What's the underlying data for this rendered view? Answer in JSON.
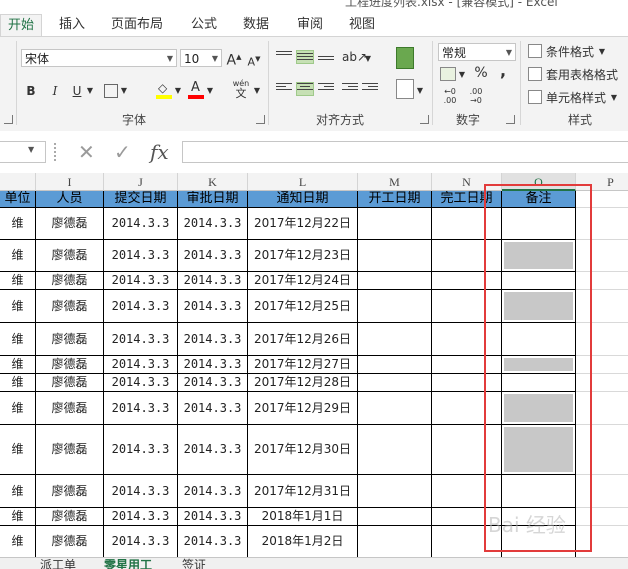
{
  "window": {
    "title": "工程进度列表.xlsx - [兼容模式] - Excel"
  },
  "tabs": [
    "开始",
    "插入",
    "页面布局",
    "公式",
    "数据",
    "审阅",
    "视图"
  ],
  "ribbon": {
    "font_name": "宋体",
    "font_size": "10",
    "grow_font": "A",
    "shrink_font": "A",
    "bold": "B",
    "italic": "I",
    "underline": "U",
    "font_color_letter": "A",
    "phonetic": "wén",
    "phonetic_sub": "文",
    "number_format": "常规",
    "percent": "%",
    "comma": ",",
    "conditional_formatting": "条件格式",
    "format_as_table": "套用表格格式",
    "cell_styles": "单元格样式",
    "group_font": "字体",
    "group_alignment": "对齐方式",
    "group_number": "数字",
    "group_styles": "样式",
    "dec_increase_top": "←0",
    "dec_increase_bottom": ".00",
    "dec_decrease_top": ".00",
    "dec_decrease_bottom": "→0"
  },
  "formula_bar": {
    "fx": "fx",
    "cancel": "✕",
    "enter": "✓",
    "content": ""
  },
  "columns": [
    "I",
    "J",
    "K",
    "L",
    "M",
    "N",
    "O",
    "P"
  ],
  "table": {
    "headers": [
      "单位",
      "人员",
      "提交日期",
      "审批日期",
      "通知日期",
      "开工日期",
      "完工日期",
      "备注"
    ],
    "rows": [
      {
        "unit": "维",
        "person": "廖德磊",
        "submit": "2014.3.3",
        "approve": "2014.3.3",
        "notice": "2017年12月22日",
        "remark_grey": false
      },
      {
        "unit": "维",
        "person": "廖德磊",
        "submit": "2014.3.3",
        "approve": "2014.3.3",
        "notice": "2017年12月23日",
        "remark_grey": true
      },
      {
        "unit": "维",
        "person": "廖德磊",
        "submit": "2014.3.3",
        "approve": "2014.3.3",
        "notice": "2017年12月24日",
        "remark_grey": false
      },
      {
        "unit": "维",
        "person": "廖德磊",
        "submit": "2014.3.3",
        "approve": "2014.3.3",
        "notice": "2017年12月25日",
        "remark_grey": true
      },
      {
        "unit": "维",
        "person": "廖德磊",
        "submit": "2014.3.3",
        "approve": "2014.3.3",
        "notice": "2017年12月26日",
        "remark_grey": false
      },
      {
        "unit": "维",
        "person": "廖德磊",
        "submit": "2014.3.3",
        "approve": "2014.3.3",
        "notice": "2017年12月27日",
        "remark_grey": true
      },
      {
        "unit": "维",
        "person": "廖德磊",
        "submit": "2014.3.3",
        "approve": "2014.3.3",
        "notice": "2017年12月28日",
        "remark_grey": false
      },
      {
        "unit": "维",
        "person": "廖德磊",
        "submit": "2014.3.3",
        "approve": "2014.3.3",
        "notice": "2017年12月29日",
        "remark_grey": true
      },
      {
        "unit": "维",
        "person": "廖德磊",
        "submit": "2014.3.3",
        "approve": "2014.3.3",
        "notice": "2017年12月30日",
        "remark_grey": true
      },
      {
        "unit": "维",
        "person": "廖德磊",
        "submit": "2014.3.3",
        "approve": "2014.3.3",
        "notice": "2017年12月31日",
        "remark_grey": false
      },
      {
        "unit": "维",
        "person": "廖德磊",
        "submit": "2014.3.3",
        "approve": "2014.3.3",
        "notice": "2018年1月1日",
        "remark_grey": false
      },
      {
        "unit": "维",
        "person": "廖德磊",
        "submit": "2014.3.3",
        "approve": "2014.3.3",
        "notice": "2018年1月2日",
        "remark_grey": false
      }
    ]
  },
  "sheets": [
    "派工单",
    "零星用工",
    "签证"
  ],
  "watermark": "Bai 经验",
  "colors": {
    "accent": "#217346",
    "header_fill": "#5b9bd5",
    "highlight_box": "#e23b3b",
    "grey_cell": "#c8c8c8"
  }
}
